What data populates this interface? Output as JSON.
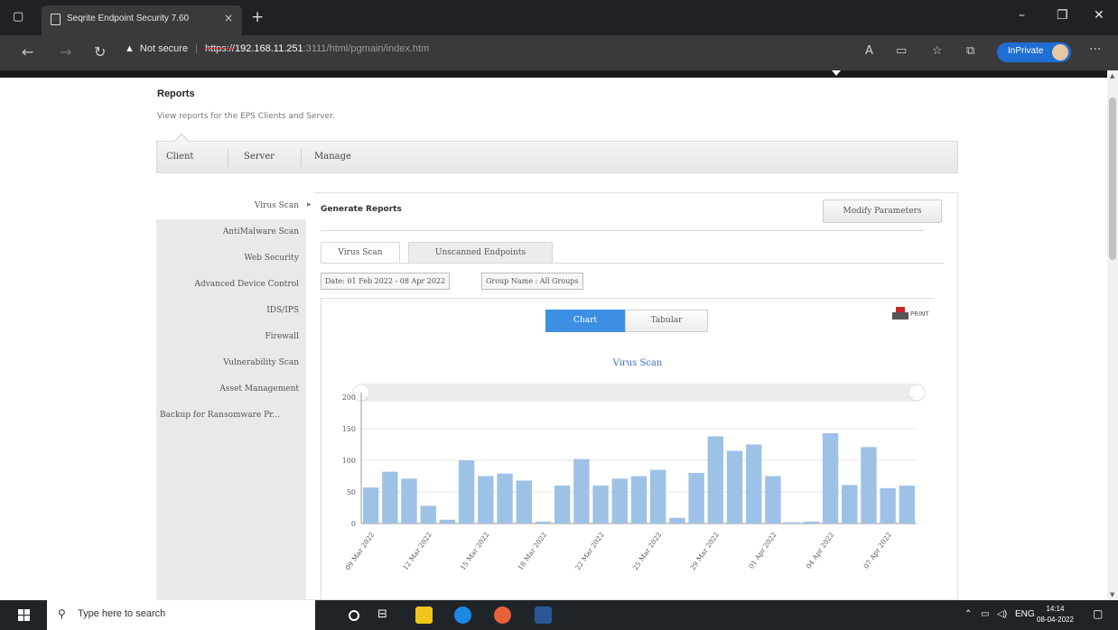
{
  "browser": {
    "tab_title": "Seqrite Endpoint Security 7.60",
    "tab_close": "×",
    "new_tab": "+",
    "security_warning": "Not secure",
    "url_protocol": "https://",
    "url_host": "192.168.11.251",
    "url_path": ":3111/html/pgmain/index.htm",
    "inprivate_label": "InPrivate",
    "more": "···"
  },
  "page": {
    "title": "Reports",
    "subtitle": "View reports for the EPS Clients and Server."
  },
  "main_nav": [
    "Client",
    "Server",
    "Manage"
  ],
  "sidebar": [
    "Virus Scan",
    "AntiMalware Scan",
    "Web Security",
    "Advanced Device Control",
    "IDS/IPS",
    "Firewall",
    "Vulnerability Scan",
    "Asset Management",
    "Backup for Ransomware Pr..."
  ],
  "sidebar_arrow": "▸",
  "reports": {
    "heading": "Generate Reports",
    "modify_button": "Modify Parameters",
    "subtabs": [
      "Virus Scan",
      "Unscanned Endpoints"
    ],
    "filter_date": "Date: 01 Feb 2022 - 08 Apr 2022",
    "filter_group": "Group Name : All Groups",
    "toggle_chart": "Chart",
    "toggle_tabular": "Tabular",
    "print_label": "PRINT"
  },
  "chart_data": {
    "type": "bar",
    "title": "Virus Scan",
    "ylim": [
      0,
      200
    ],
    "yticks": [
      0,
      50,
      100,
      150,
      200
    ],
    "values": [
      57,
      82,
      71,
      28,
      6,
      100,
      75,
      79,
      68,
      3,
      60,
      102,
      60,
      71,
      75,
      85,
      9,
      80,
      138,
      115,
      125,
      75,
      2,
      3,
      143,
      61,
      121,
      56,
      60
    ],
    "xtick_labels": [
      "09 Mar 2022",
      "12 Mar 2022",
      "15 Mar 2022",
      "18 Mar 2022",
      "22 Mar 2022",
      "25 Mar 2022",
      "29 Mar 2022",
      "01 Apr 2022",
      "04 Apr 2022",
      "07 Apr 2022"
    ],
    "bar_color": "#9ec1e6"
  },
  "taskbar": {
    "search_placeholder": "Type here to search",
    "lang": "ENG",
    "time": "14:14",
    "date": "08-04-2022"
  }
}
